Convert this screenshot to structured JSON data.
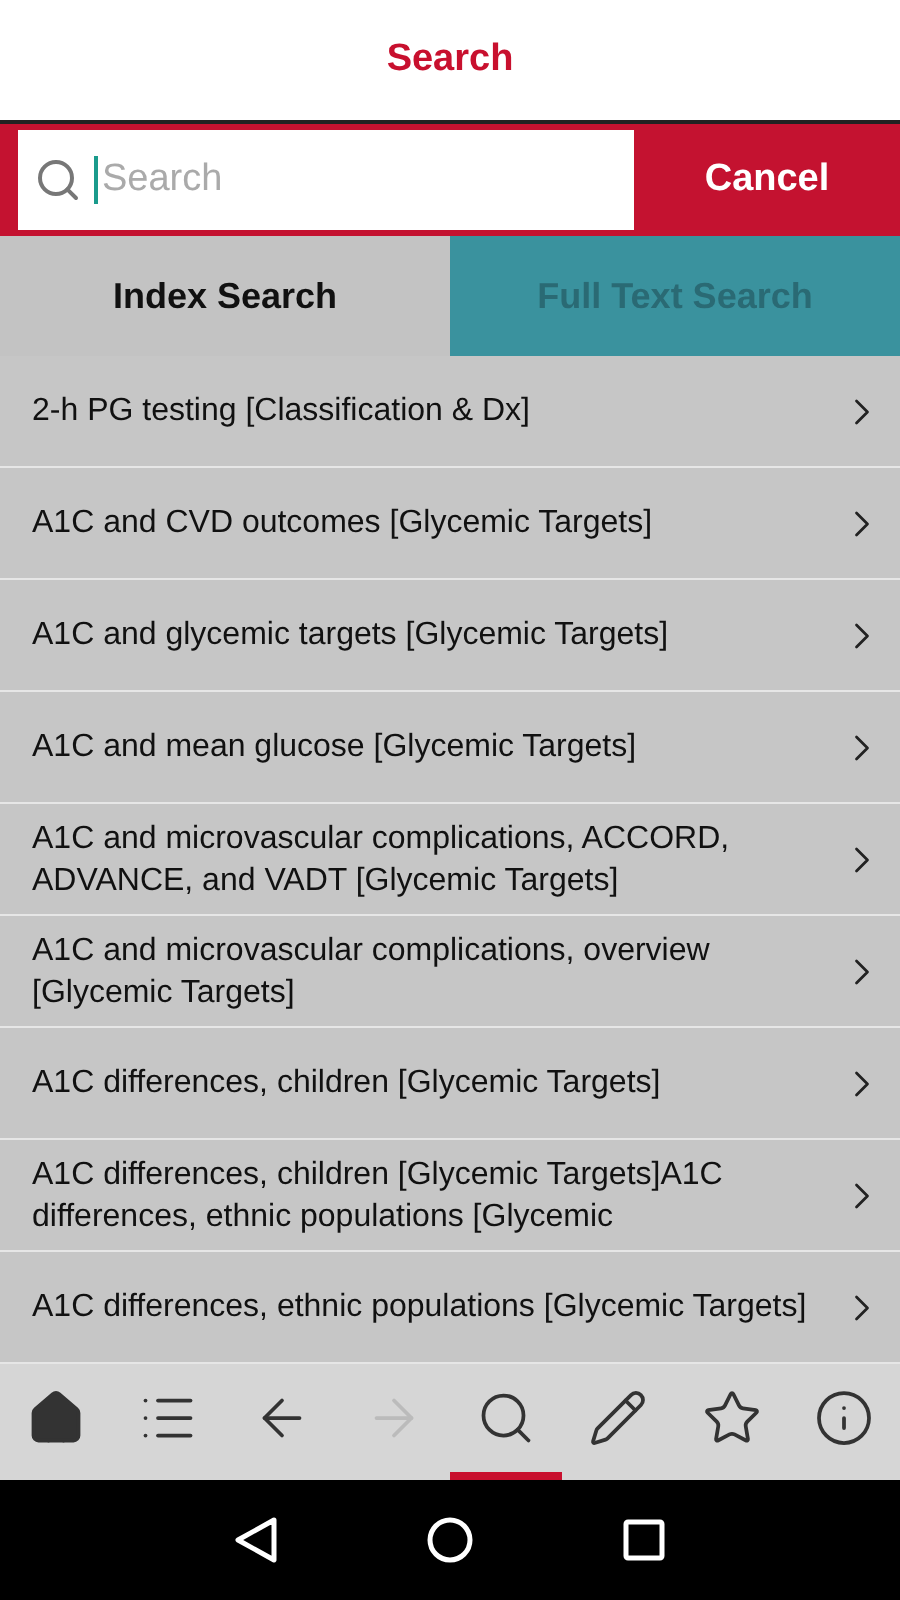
{
  "header": {
    "title": "Search"
  },
  "search": {
    "placeholder": "Search",
    "cancel": "Cancel"
  },
  "tabs": [
    {
      "label": "Index Search",
      "selected": true
    },
    {
      "label": "Full Text Search",
      "selected": false
    }
  ],
  "results": [
    {
      "text": "2-h PG testing [Classification & Dx]"
    },
    {
      "text": "A1C and CVD outcomes [Glycemic Targets]"
    },
    {
      "text": "A1C and glycemic targets [Glycemic Targets]"
    },
    {
      "text": "A1C and mean glucose [Glycemic Targets]"
    },
    {
      "text": "A1C and microvascular complications, ACCORD, ADVANCE, and VADT [Glycemic Targets]"
    },
    {
      "text": "A1C and microvascular complications, overview [Glycemic Targets]"
    },
    {
      "text": "A1C differences, children [Glycemic Targets]"
    },
    {
      "text": "A1C differences, children [Glycemic Targets]A1C differences, ethnic populations [Glycemic"
    },
    {
      "text": "A1C differences, ethnic populations [Glycemic Targets]"
    }
  ],
  "toolbar": [
    {
      "kind": "home",
      "selected": false,
      "disabled": false
    },
    {
      "kind": "contents",
      "selected": false,
      "disabled": false
    },
    {
      "kind": "back",
      "selected": false,
      "disabled": false
    },
    {
      "kind": "forward",
      "selected": false,
      "disabled": true
    },
    {
      "kind": "search",
      "selected": true,
      "disabled": false
    },
    {
      "kind": "notes",
      "selected": false,
      "disabled": false
    },
    {
      "kind": "favorites",
      "selected": false,
      "disabled": false
    },
    {
      "kind": "info",
      "selected": false,
      "disabled": false
    }
  ]
}
